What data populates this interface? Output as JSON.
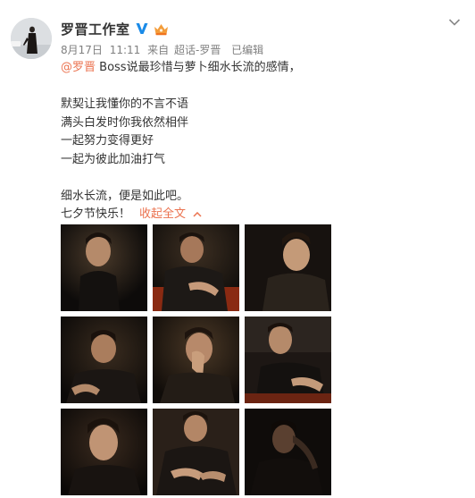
{
  "author": {
    "name": "罗晋工作室",
    "verified_icon": "blue-v-verified-icon",
    "member_icon": "member-crown-icon"
  },
  "meta": {
    "date": "8月17日",
    "time": "11:11",
    "source_prefix": "来自",
    "source": "超话-罗晋",
    "edited": "已编辑"
  },
  "post": {
    "mention": "@罗晋",
    "line1_rest": " Boss说最珍惜与萝卜细水长流的感情，",
    "line2": "默契让我懂你的不言不语",
    "line3": "满头白发时你我依然相伴",
    "line4": "一起努力变得更好",
    "line5": "一起为彼此加油打气",
    "line6": "细水长流，便是如此吧。",
    "line7": "七夕节快乐！",
    "collapse_label": "收起全文"
  },
  "colors": {
    "link": "#eb7350",
    "meta": "#808080",
    "text": "#333333",
    "verified": "#1a8be8"
  },
  "photos": [
    {
      "name": "photo-1"
    },
    {
      "name": "photo-2"
    },
    {
      "name": "photo-3"
    },
    {
      "name": "photo-4"
    },
    {
      "name": "photo-5"
    },
    {
      "name": "photo-6"
    },
    {
      "name": "photo-7"
    },
    {
      "name": "photo-8"
    },
    {
      "name": "photo-9"
    }
  ]
}
